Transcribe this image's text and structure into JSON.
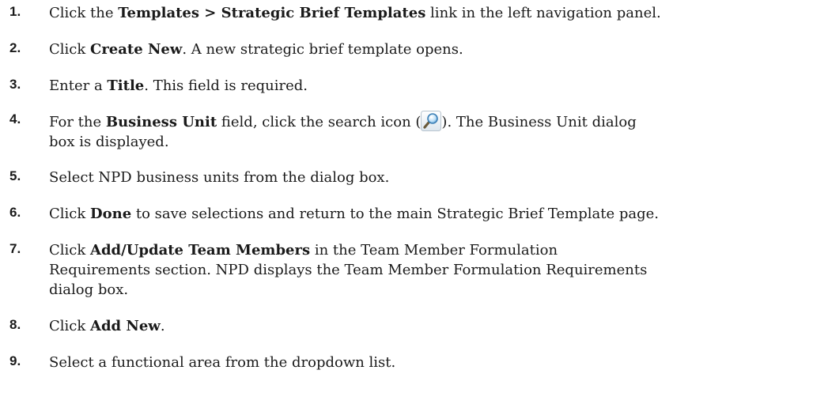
{
  "steps": [
    {
      "number": "1.",
      "t1": "Click the ",
      "b1": "Templates > Strategic Brief Templates",
      "t2": " link in the left navigation panel."
    },
    {
      "number": "2.",
      "t1": "Click ",
      "b1": "Create New",
      "t2": ". A new strategic brief template opens."
    },
    {
      "number": "3.",
      "t1": "Enter a ",
      "b1": "Title",
      "t2": ". This field is required."
    },
    {
      "number": "4.",
      "t1": "For the ",
      "b1": "Business Unit",
      "t2": " field, click the search icon (",
      "icon": "search-icon",
      "t3": "). The Business Unit dialog",
      "line2": "box is displayed."
    },
    {
      "number": "5.",
      "t1": "Select NPD business units from the dialog box."
    },
    {
      "number": "6.",
      "t1": "Click ",
      "b1": "Done",
      "t2": " to save selections and return to the main Strategic Brief Template page."
    },
    {
      "number": "7.",
      "t1": "Click ",
      "b1": "Add/Update Team Members",
      "t2": " in the Team Member Formulation",
      "line2": "Requirements section. NPD displays the Team Member Formulation Requirements",
      "line3": "dialog box."
    },
    {
      "number": "8.",
      "t1": "Click ",
      "b1": "Add New",
      "t2": "."
    },
    {
      "number": "9.",
      "t1": "Select a functional area from the dropdown list."
    }
  ]
}
